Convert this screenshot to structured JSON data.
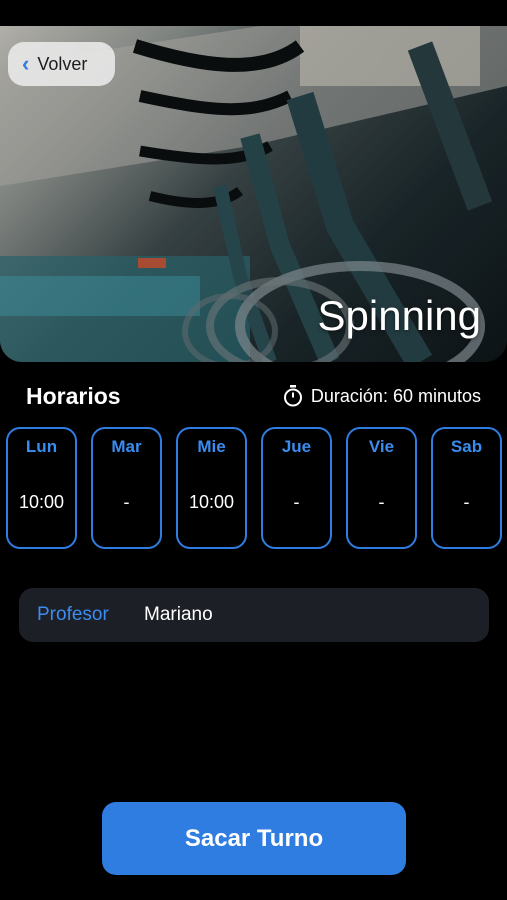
{
  "header": {
    "back_label": "Volver",
    "title": "Spinning"
  },
  "schedule": {
    "heading": "Horarios",
    "duration_label": "Duración: 60 minutos",
    "days": [
      {
        "name": "Lun",
        "time": "10:00"
      },
      {
        "name": "Mar",
        "time": "-"
      },
      {
        "name": "Mie",
        "time": "10:00"
      },
      {
        "name": "Jue",
        "time": "-"
      },
      {
        "name": "Vie",
        "time": "-"
      },
      {
        "name": "Sab",
        "time": "-"
      }
    ]
  },
  "teacher": {
    "label": "Profesor",
    "name": "Mariano"
  },
  "cta": {
    "label": "Sacar Turno"
  },
  "colors": {
    "accent": "#2f7de0",
    "background": "#000000",
    "card": "#1c1f26"
  },
  "icons": {
    "back": "chevron-left-icon",
    "duration": "stopwatch-icon"
  }
}
